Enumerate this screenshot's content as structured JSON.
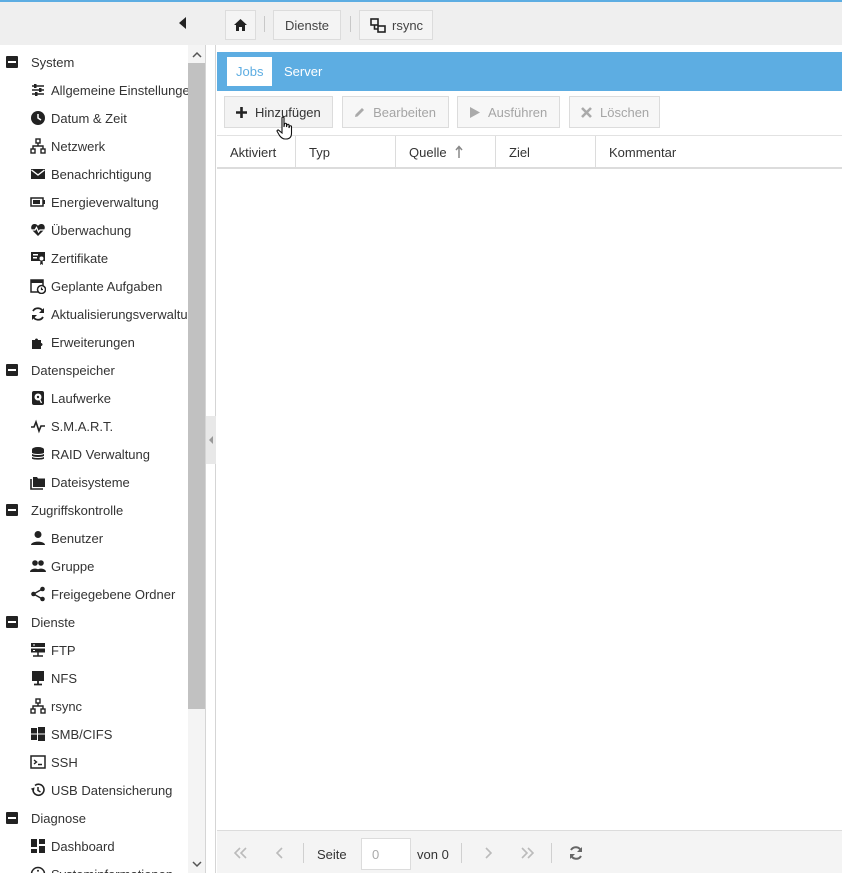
{
  "topbar": {
    "collapse_icon": "caret-left-icon",
    "breadcrumbs": [
      {
        "icon": "home-icon",
        "label": ""
      },
      {
        "label": "Dienste"
      },
      {
        "icon": "network-icon",
        "label": "rsync"
      }
    ]
  },
  "sidebar": {
    "groups": [
      {
        "label": "System",
        "items": [
          {
            "label": "Allgemeine Einstellungen",
            "icon": "sliders-icon"
          },
          {
            "label": "Datum & Zeit",
            "icon": "clock-icon"
          },
          {
            "label": "Netzwerk",
            "icon": "network-icon"
          },
          {
            "label": "Benachrichtigung",
            "icon": "mail-icon"
          },
          {
            "label": "Energieverwaltung",
            "icon": "battery-icon"
          },
          {
            "label": "Überwachung",
            "icon": "heart-pulse-icon"
          },
          {
            "label": "Zertifikate",
            "icon": "certificate-icon"
          },
          {
            "label": "Geplante Aufgaben",
            "icon": "calendar-clock-icon"
          },
          {
            "label": "Aktualisierungsverwaltung",
            "icon": "refresh-icon"
          },
          {
            "label": "Erweiterungen",
            "icon": "puzzle-icon"
          }
        ]
      },
      {
        "label": "Datenspeicher",
        "items": [
          {
            "label": "Laufwerke",
            "icon": "harddisk-icon"
          },
          {
            "label": "S.M.A.R.T.",
            "icon": "pulse-icon"
          },
          {
            "label": "RAID Verwaltung",
            "icon": "database-icon"
          },
          {
            "label": "Dateisysteme",
            "icon": "folders-icon"
          }
        ]
      },
      {
        "label": "Zugriffskontrolle",
        "items": [
          {
            "label": "Benutzer",
            "icon": "user-icon"
          },
          {
            "label": "Gruppe",
            "icon": "users-icon"
          },
          {
            "label": "Freigegebene Ordner",
            "icon": "share-icon"
          }
        ]
      },
      {
        "label": "Dienste",
        "items": [
          {
            "label": "FTP",
            "icon": "server-icon"
          },
          {
            "label": "NFS",
            "icon": "desktop-icon"
          },
          {
            "label": "rsync",
            "icon": "network-icon"
          },
          {
            "label": "SMB/CIFS",
            "icon": "windows-icon"
          },
          {
            "label": "SSH",
            "icon": "terminal-icon"
          },
          {
            "label": "USB Datensicherung",
            "icon": "history-icon"
          }
        ]
      },
      {
        "label": "Diagnose",
        "items": [
          {
            "label": "Dashboard",
            "icon": "dashboard-icon"
          },
          {
            "label": "Systeminformationen",
            "icon": "info-icon"
          }
        ]
      }
    ]
  },
  "tabs": [
    {
      "label": "Jobs",
      "active": true
    },
    {
      "label": "Server",
      "active": false
    }
  ],
  "toolbar": {
    "add_label": "Hinzufügen",
    "edit_label": "Bearbeiten",
    "run_label": "Ausführen",
    "delete_label": "Löschen"
  },
  "grid": {
    "columns": [
      "Aktiviert",
      "Typ",
      "Quelle",
      "Ziel",
      "Kommentar"
    ],
    "sorted_column": "Quelle",
    "sort_direction": "ascending",
    "rows": []
  },
  "pager": {
    "page_label": "Seite",
    "page_value": "0",
    "of_label": "von 0"
  },
  "colors": {
    "accent": "#5dade2",
    "topbar_bg": "#efefef"
  }
}
